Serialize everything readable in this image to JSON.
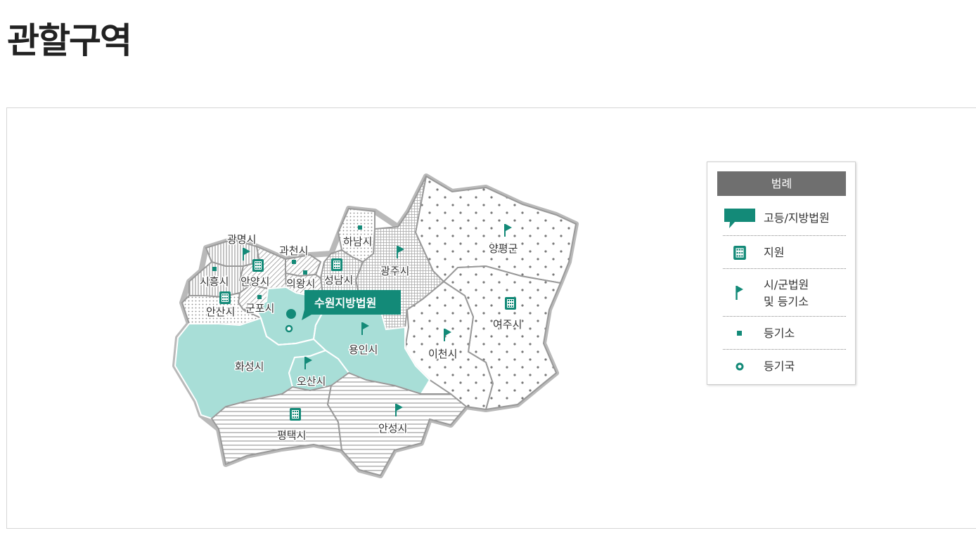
{
  "page": {
    "title": "관할구역"
  },
  "colors": {
    "accent": "#138a78",
    "court_area": "#a8ded7",
    "border": "#9a9a9a",
    "pattern_ink": "#777777",
    "legend_header": "#6f6f6f"
  },
  "map": {
    "court_label": "수원지방법원",
    "regions": [
      {
        "name": "광명시",
        "pattern": "vertical-lines",
        "marker": "city-court-flag"
      },
      {
        "name": "과천시",
        "pattern": "diagonal-lines",
        "marker": "registry-office-square"
      },
      {
        "name": "하남시",
        "pattern": "dots-small",
        "marker": "registry-office-square"
      },
      {
        "name": "양평군",
        "pattern": "dots-large",
        "marker": "city-court-flag"
      },
      {
        "name": "광주시",
        "pattern": "grid",
        "marker": "city-court-flag"
      },
      {
        "name": "시흥시",
        "pattern": "vertical-lines",
        "marker": "registry-office-square"
      },
      {
        "name": "안양시",
        "pattern": "diagonal-lines",
        "marker": "branch-court-building"
      },
      {
        "name": "의왕시",
        "pattern": "diagonal-lines",
        "marker": "registry-office-square"
      },
      {
        "name": "성남시",
        "pattern": "grid",
        "marker": "branch-court-building"
      },
      {
        "name": "안산시",
        "pattern": "dots-small",
        "marker": "branch-court-building"
      },
      {
        "name": "군포시",
        "pattern": "diagonal-lines",
        "marker": "registry-office-square"
      },
      {
        "name": "여주시",
        "pattern": "dots-large",
        "marker": "branch-court-building"
      },
      {
        "name": "용인시",
        "pattern": "solid-court",
        "marker": "city-court-flag"
      },
      {
        "name": "이천시",
        "pattern": "dots-large",
        "marker": "city-court-flag"
      },
      {
        "name": "화성시",
        "pattern": "solid-court",
        "marker": "none"
      },
      {
        "name": "오산시",
        "pattern": "solid-court",
        "marker": "city-court-flag"
      },
      {
        "name": "평택시",
        "pattern": "horizontal-lines",
        "marker": "branch-court-building"
      },
      {
        "name": "안성시",
        "pattern": "horizontal-lines",
        "marker": "city-court-flag"
      }
    ]
  },
  "legend": {
    "title": "범례",
    "items": [
      {
        "icon": "court-speech-bubble-icon",
        "label": "고등/지방법원"
      },
      {
        "icon": "building-icon",
        "label": "지원"
      },
      {
        "icon": "flag-icon",
        "label_line1": "시/군법원",
        "label_line2": "및 등기소"
      },
      {
        "icon": "square-dot-icon",
        "label": "등기소"
      },
      {
        "icon": "ring-icon",
        "label": "등기국"
      }
    ]
  }
}
